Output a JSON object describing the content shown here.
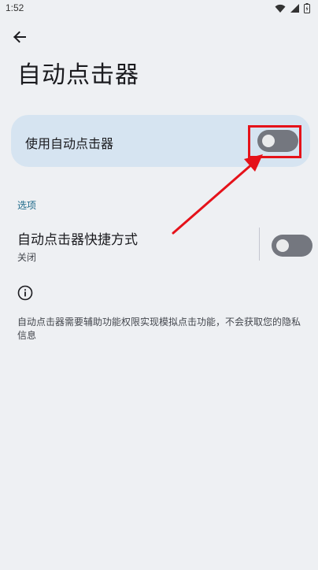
{
  "status_bar": {
    "time": "1:52",
    "icons": [
      "wifi-icon",
      "cellular-signal-icon",
      "battery-icon"
    ]
  },
  "header": {
    "back_icon": "back-arrow-icon",
    "title": "自动点击器"
  },
  "main_toggle": {
    "label": "使用自动点击器",
    "enabled": false,
    "highlighted": true
  },
  "options_section": {
    "header": "选项",
    "shortcut": {
      "title": "自动点击器快捷方式",
      "status": "关闭",
      "enabled": false
    }
  },
  "info": {
    "icon": "info-icon",
    "text": "自动点击器需要辅助功能权限实现模拟点击功能，不会获取您的隐私信息"
  },
  "colors": {
    "background": "#eef0f3",
    "card": "#d6e4f1",
    "switch_off": "#74777f",
    "section_header": "#1f6a8a",
    "annotation_red": "#e5121a"
  }
}
